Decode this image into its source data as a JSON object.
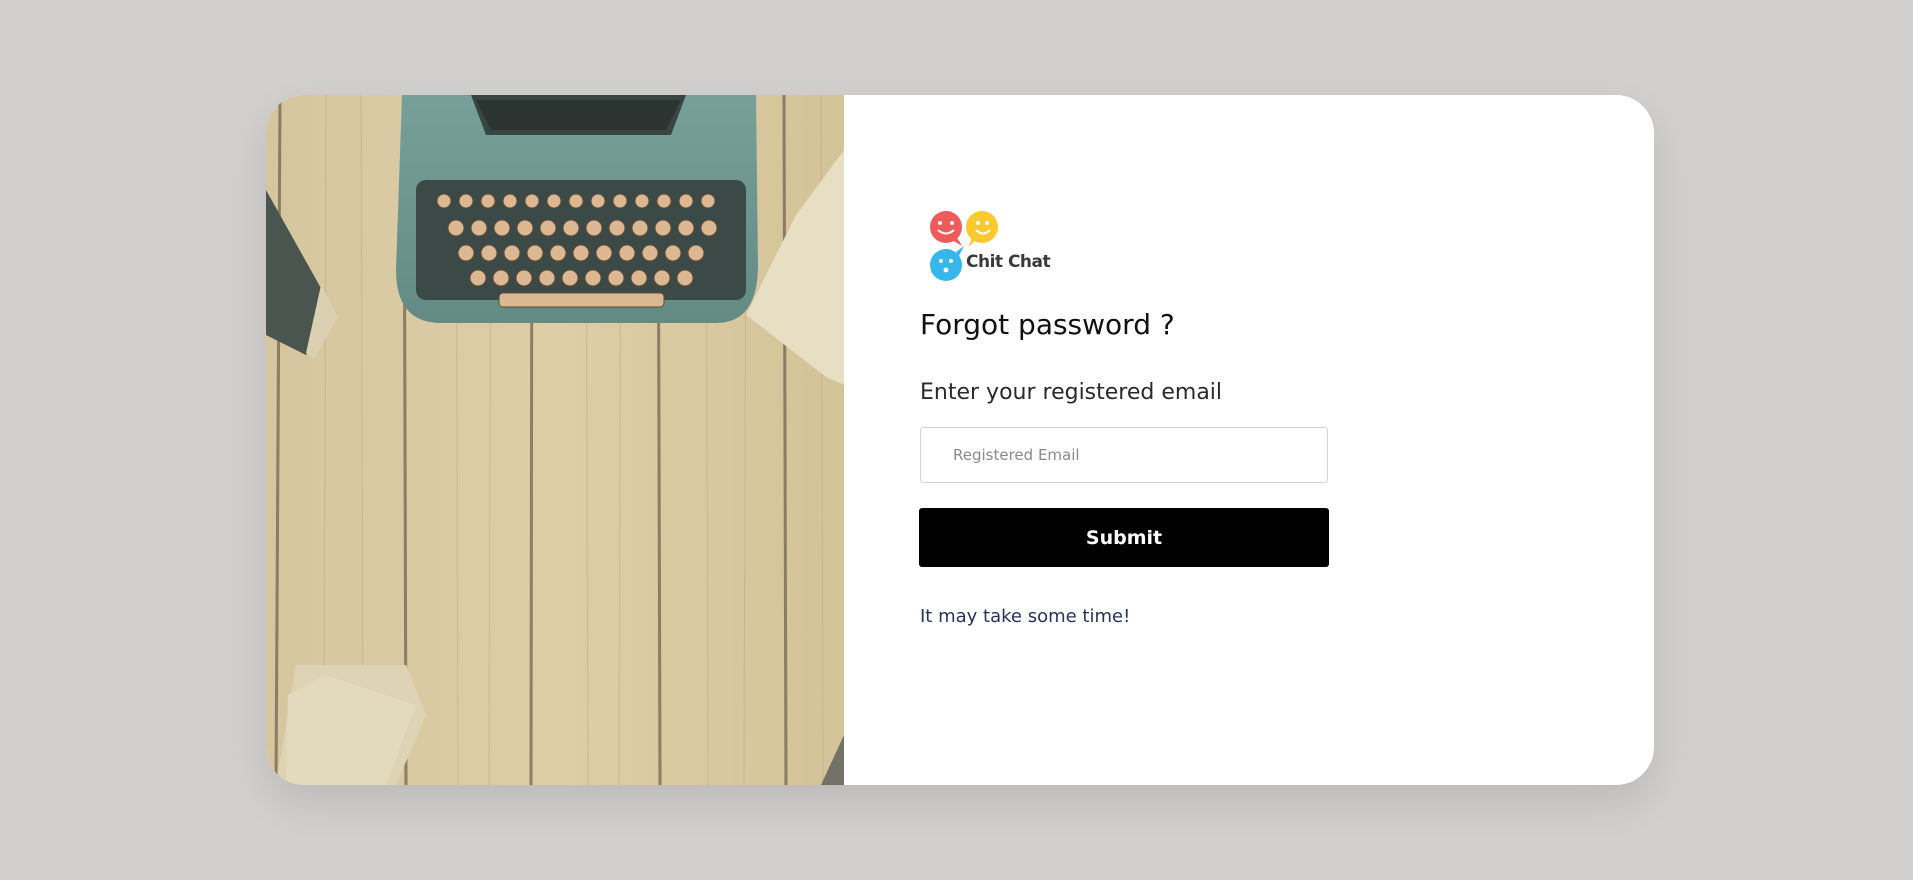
{
  "brand": {
    "name": "Chit Chat",
    "colors": {
      "bubble_red": "#ef5b5b",
      "bubble_yellow": "#f9c92d",
      "bubble_blue": "#35b7ec"
    }
  },
  "form": {
    "title": "Forgot password ?",
    "email_label": "Enter your registered email",
    "email_placeholder": "Registered Email",
    "email_value": "",
    "submit_label": "Submit",
    "note": "It may take some time!"
  },
  "hero_image": {
    "subject": "vintage typewriter on wooden desk"
  }
}
